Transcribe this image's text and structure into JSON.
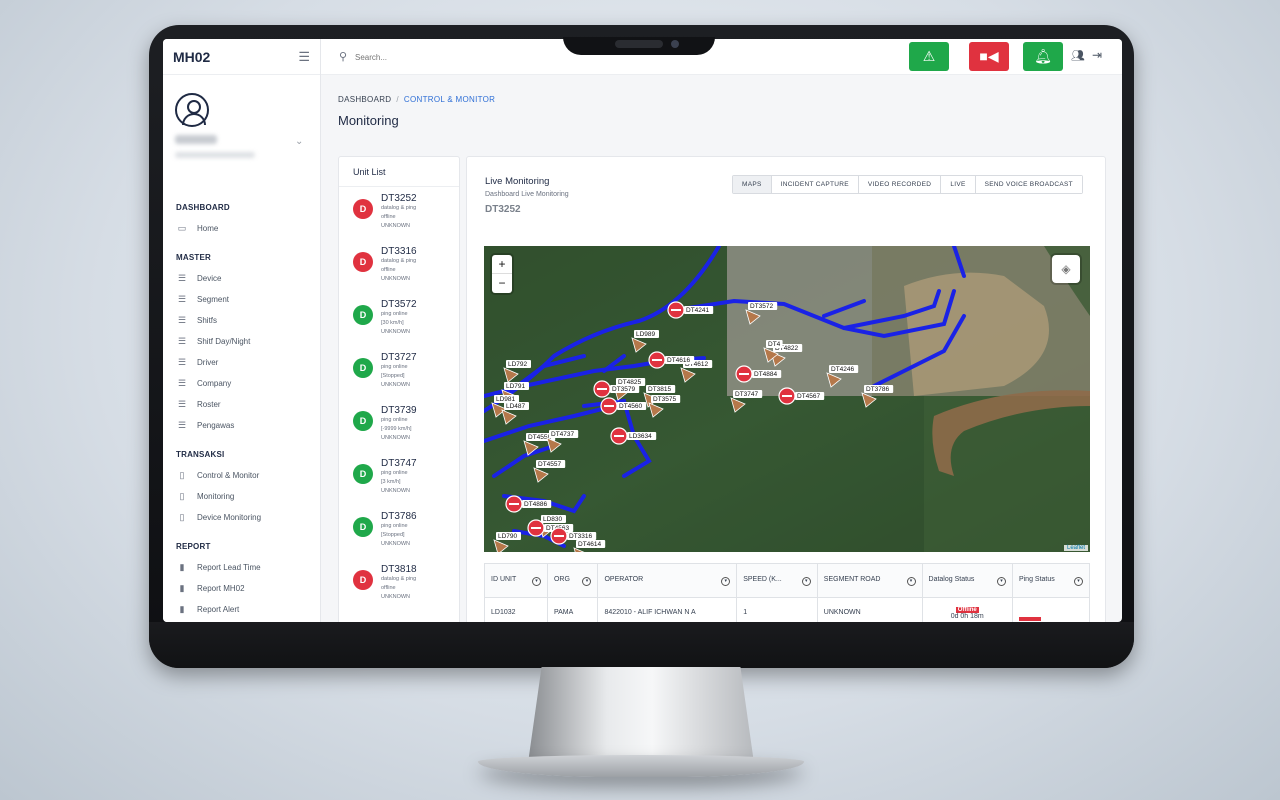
{
  "app": {
    "brand": "MH02"
  },
  "search": {
    "placeholder": "Search..."
  },
  "sidebar": {
    "sections": [
      {
        "title": "DASHBOARD",
        "items": [
          {
            "label": "Home",
            "icon": "monitor-icon"
          }
        ]
      },
      {
        "title": "MASTER",
        "items": [
          {
            "label": "Device",
            "icon": "database-icon"
          },
          {
            "label": "Segment",
            "icon": "database-icon"
          },
          {
            "label": "Shitfs",
            "icon": "database-icon"
          },
          {
            "label": "Shitf Day/Night",
            "icon": "database-icon"
          },
          {
            "label": "Driver",
            "icon": "database-icon"
          },
          {
            "label": "Company",
            "icon": "database-icon"
          },
          {
            "label": "Roster",
            "icon": "database-icon"
          },
          {
            "label": "Pengawas",
            "icon": "database-icon"
          }
        ]
      },
      {
        "title": "TRANSAKSI",
        "items": [
          {
            "label": "Control & Monitor",
            "icon": "clipboard-icon"
          },
          {
            "label": "Monitoring",
            "icon": "clipboard-icon"
          },
          {
            "label": "Device Monitoring",
            "icon": "clipboard-icon"
          }
        ]
      },
      {
        "title": "REPORT",
        "items": [
          {
            "label": "Report Lead Time",
            "icon": "bar-chart-icon"
          },
          {
            "label": "Report MH02",
            "icon": "bar-chart-icon"
          },
          {
            "label": "Report Alert",
            "icon": "bar-chart-icon"
          }
        ]
      }
    ]
  },
  "breadcrumb": {
    "root": "DASHBOARD",
    "sep": "/",
    "current": "CONTROL & MONITOR"
  },
  "page": {
    "title": "Monitoring"
  },
  "unit_list": {
    "title": "Unit List",
    "items": [
      {
        "badge": "D",
        "color": "#e0323f",
        "id": "DT3252",
        "lines": [
          "datalog & ping",
          "offline",
          "UNKNOWN"
        ]
      },
      {
        "badge": "D",
        "color": "#e0323f",
        "id": "DT3316",
        "lines": [
          "datalog & ping",
          "offline",
          "UNKNOWN"
        ]
      },
      {
        "badge": "D",
        "color": "#1fa84a",
        "id": "DT3572",
        "lines": [
          "ping online",
          "[30 km/h]",
          "UNKNOWN"
        ]
      },
      {
        "badge": "D",
        "color": "#1fa84a",
        "id": "DT3727",
        "lines": [
          "ping online",
          "[Stopped]",
          "UNKNOWN"
        ]
      },
      {
        "badge": "D",
        "color": "#1fa84a",
        "id": "DT3739",
        "lines": [
          "ping online",
          "[-9999 km/h]",
          "UNKNOWN"
        ]
      },
      {
        "badge": "D",
        "color": "#1fa84a",
        "id": "DT3747",
        "lines": [
          "ping online",
          "[3 km/h]",
          "UNKNOWN"
        ]
      },
      {
        "badge": "D",
        "color": "#1fa84a",
        "id": "DT3786",
        "lines": [
          "ping online",
          "[Stopped]",
          "UNKNOWN"
        ]
      },
      {
        "badge": "D",
        "color": "#e0323f",
        "id": "DT3818",
        "lines": [
          "datalog & ping",
          "offline",
          "UNKNOWN"
        ]
      }
    ]
  },
  "live": {
    "title": "Live Monitoring",
    "subtitle": "Dashboard Live Monitoring",
    "unit": "DT3252",
    "tabs": [
      "MAPS",
      "INCIDENT CAPTURE",
      "VIDEO RECORDED",
      "LIVE",
      "SEND VOICE BROADCAST"
    ],
    "active_tab": "MAPS"
  },
  "map": {
    "zoom_in": "+",
    "zoom_out": "−",
    "attribution": "Leaflet",
    "markers_red": [
      {
        "label": "DT4241"
      },
      {
        "label": "DT4616"
      },
      {
        "label": "DT4884"
      },
      {
        "label": "DT4567"
      },
      {
        "label": "DT3579"
      },
      {
        "label": "DT4560"
      },
      {
        "label": "LD3634"
      },
      {
        "label": "DT4886"
      },
      {
        "label": "DT4563"
      },
      {
        "label": "DT3316"
      }
    ],
    "markers_arrow": [
      {
        "label": "DT3572"
      },
      {
        "label": "LD989"
      },
      {
        "label": "DT4612"
      },
      {
        "label": "DT4822"
      },
      {
        "label": "DT4246"
      },
      {
        "label": "DT3786"
      },
      {
        "label": "DT4825"
      },
      {
        "label": "DT3815"
      },
      {
        "label": "DT3575"
      },
      {
        "label": "DT3747"
      },
      {
        "label": "LD792"
      },
      {
        "label": "LD791"
      },
      {
        "label": "LD981"
      },
      {
        "label": "LD487"
      },
      {
        "label": "DT4558"
      },
      {
        "label": "DT4737"
      },
      {
        "label": "DT4557"
      },
      {
        "label": "LD830"
      },
      {
        "label": "LD790"
      },
      {
        "label": "DT4614"
      },
      {
        "label": "DT4"
      }
    ]
  },
  "table": {
    "headers": [
      "ID UNIT",
      "ORG",
      "OPERATOR",
      "SPEED (K...",
      "SEGMENT ROAD",
      "Datalog Status",
      "Ping Status"
    ],
    "rows": [
      {
        "id": "LD1032",
        "org": "PAMA",
        "operator": "8422010 - ALIF ICHWAN N A",
        "speed": "1",
        "segment": "UNKNOWN",
        "datalog_badge": "Offline",
        "datalog_time": "0d 0h 18m",
        "ping": ""
      }
    ]
  }
}
